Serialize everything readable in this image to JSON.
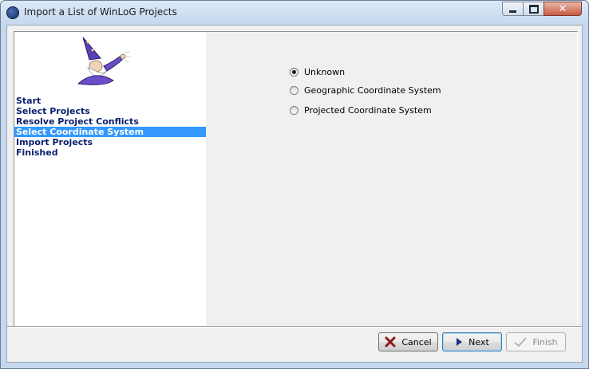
{
  "window": {
    "title": "Import a List of WinLoG Projects"
  },
  "steps": [
    {
      "label": "Start",
      "active": false
    },
    {
      "label": "Select Projects",
      "active": false
    },
    {
      "label": "Resolve Project Conflicts",
      "active": false
    },
    {
      "label": "Select Coordinate System",
      "active": true
    },
    {
      "label": "Import Projects",
      "active": false
    },
    {
      "label": "Finished",
      "active": false
    }
  ],
  "options": {
    "unknown": {
      "label": "Unknown",
      "checked": true
    },
    "geographic": {
      "label": "Geographic Coordinate System",
      "checked": false
    },
    "projected": {
      "label": "Projected Coordinate System",
      "checked": false
    }
  },
  "buttons": {
    "cancel": "Cancel",
    "next": "Next",
    "finish": "Finish"
  },
  "icons": {
    "app": "globe-icon",
    "wizard": "wizard-illustration",
    "cancel": "x-icon",
    "next": "play-arrow-icon",
    "finish": "checkmark-icon"
  },
  "colors": {
    "selection": "#3399ff",
    "step_text": "#0a1f6e",
    "close_button": "#c75b42"
  }
}
